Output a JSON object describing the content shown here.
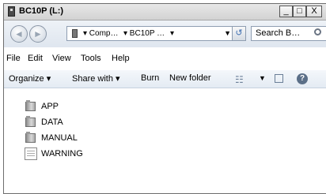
{
  "window": {
    "title": "BC10P (L:)",
    "controls": {
      "minimize": "_",
      "maximize": "□",
      "close": "X"
    }
  },
  "nav": {
    "back_glyph": "◄",
    "forward_glyph": "►",
    "breadcrumb": [
      "▾ Comp…",
      "▾ BC10P …",
      "▾"
    ],
    "dropdown_glyph": "▼",
    "search_placeholder": "Search B…"
  },
  "menu": [
    "File",
    "Edit",
    "View",
    "Tools",
    "Help"
  ],
  "toolbar": {
    "organize": "Organize ▾",
    "share_with": "Share with ▾",
    "burn": "Burn",
    "new_folder": "New folder"
  },
  "files": [
    {
      "name": "APP",
      "type": "folder"
    },
    {
      "name": "DATA",
      "type": "folder"
    },
    {
      "name": "MANUAL",
      "type": "folder"
    },
    {
      "name": "WARNING",
      "type": "file"
    }
  ]
}
